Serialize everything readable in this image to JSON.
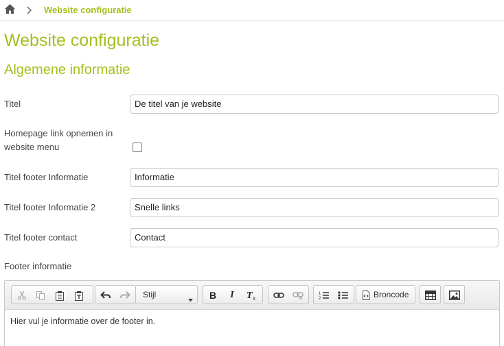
{
  "breadcrumb": {
    "home_icon": "home-icon",
    "separator_icon": "chevron-right-icon",
    "current": "Website configuratie"
  },
  "page": {
    "title": "Website configuratie",
    "section_title": "Algemene informatie"
  },
  "form": {
    "titel": {
      "label": "Titel",
      "value": "De titel van je website"
    },
    "homepage_link": {
      "label": "Homepage link opnemen in website menu",
      "checked": false
    },
    "footer_informatie": {
      "label": "Titel footer Informatie",
      "value": "Informatie"
    },
    "footer_informatie_2": {
      "label": "Titel footer Informatie 2",
      "value": "Snelle links"
    },
    "footer_contact": {
      "label": "Titel footer contact",
      "value": "Contact"
    },
    "footer_text": {
      "label": "Footer informatie"
    }
  },
  "editor": {
    "style_select": "Stijl",
    "source_button": "Broncode",
    "content": "Hier vul je informatie over de footer in.",
    "icons": [
      "cut-icon",
      "copy-icon",
      "paste-icon",
      "paste-text-icon",
      "undo-icon",
      "redo-icon",
      "bold-icon",
      "italic-icon",
      "remove-format-icon",
      "link-icon",
      "unlink-icon",
      "numbered-list-icon",
      "bulleted-list-icon",
      "source-icon",
      "table-icon",
      "image-icon"
    ]
  },
  "colors": {
    "accent": "#a3c020",
    "border": "#c8c8c8",
    "text": "#333333"
  }
}
